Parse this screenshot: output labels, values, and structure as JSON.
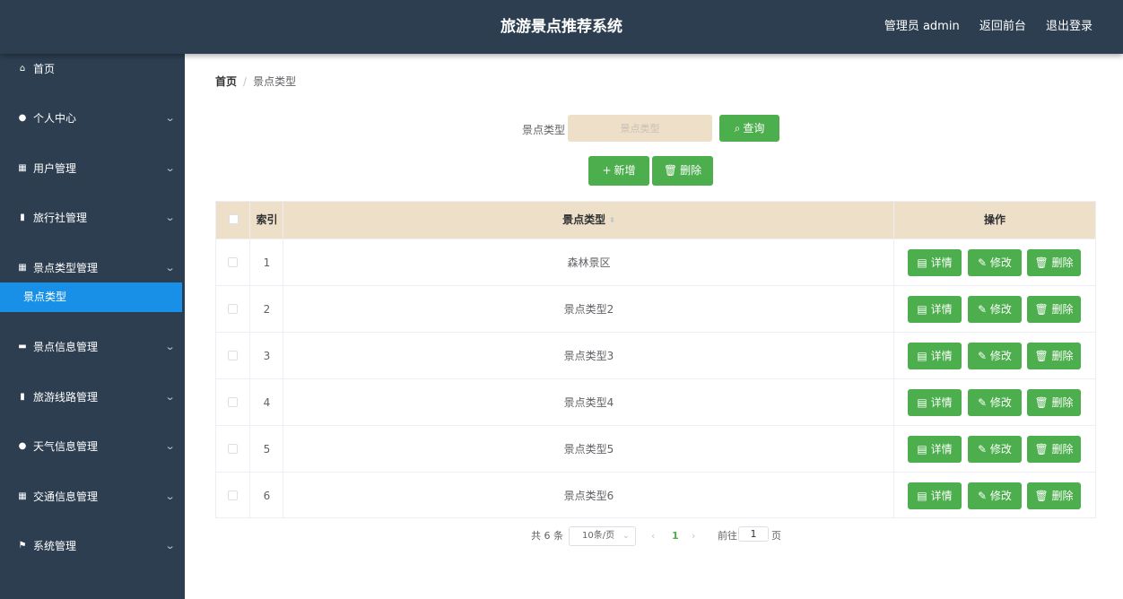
{
  "header": {
    "title": "旅游景点推荐系统",
    "admin_label": "管理员 admin",
    "back_label": "返回前台",
    "logout_label": "退出登录"
  },
  "sidebar": {
    "items": [
      {
        "label": "首页",
        "icon": "home-icon",
        "glyph": "⌂",
        "arrow": false
      },
      {
        "label": "个人中心",
        "icon": "user-icon",
        "glyph": "●",
        "arrow": true
      },
      {
        "label": "用户管理",
        "icon": "grid-icon",
        "glyph": "▦",
        "arrow": true
      },
      {
        "label": "旅行社管理",
        "icon": "clipboard-icon",
        "glyph": "▮",
        "arrow": true
      },
      {
        "label": "景点类型管理",
        "icon": "grid-icon",
        "glyph": "▦",
        "arrow": true
      },
      {
        "label": "景点信息管理",
        "icon": "ticket-icon",
        "glyph": "▬",
        "arrow": true
      },
      {
        "label": "旅游线路管理",
        "icon": "clipboard-icon",
        "glyph": "▮",
        "arrow": true
      },
      {
        "label": "天气信息管理",
        "icon": "user-icon",
        "glyph": "●",
        "arrow": true
      },
      {
        "label": "交通信息管理",
        "icon": "grid-icon",
        "glyph": "▦",
        "arrow": true
      },
      {
        "label": "系统管理",
        "icon": "flag-icon",
        "glyph": "⚑",
        "arrow": true
      }
    ],
    "active_sub": "景点类型"
  },
  "breadcrumb": {
    "home": "首页",
    "separator": "/",
    "current": "景点类型"
  },
  "search": {
    "label": "景点类型",
    "placeholder": "景点类型",
    "query_label": "查询"
  },
  "actions": {
    "add_label": "新增",
    "delete_label": "删除"
  },
  "table": {
    "columns": {
      "index": "索引",
      "type": "景点类型",
      "ops": "操作"
    },
    "row_buttons": {
      "detail": "详情",
      "edit": "修改",
      "delete": "删除"
    },
    "rows": [
      {
        "index": "1",
        "type": "森林景区"
      },
      {
        "index": "2",
        "type": "景点类型2"
      },
      {
        "index": "3",
        "type": "景点类型3"
      },
      {
        "index": "4",
        "type": "景点类型4"
      },
      {
        "index": "5",
        "type": "景点类型5"
      },
      {
        "index": "6",
        "type": "景点类型6"
      }
    ]
  },
  "pagination": {
    "total": "共 6 条",
    "page_size": "10条/页",
    "current_page": "1",
    "goto_label": "前往",
    "goto_value": "1",
    "page_suffix": "页"
  },
  "colors": {
    "header_bg": "#2c3e50",
    "sidebar_bg": "#2c3e50",
    "active_item": "#1890e8",
    "button_green": "#4cae4c",
    "table_header_bg": "#eedfc8",
    "search_input_bg": "#eedfc8"
  }
}
